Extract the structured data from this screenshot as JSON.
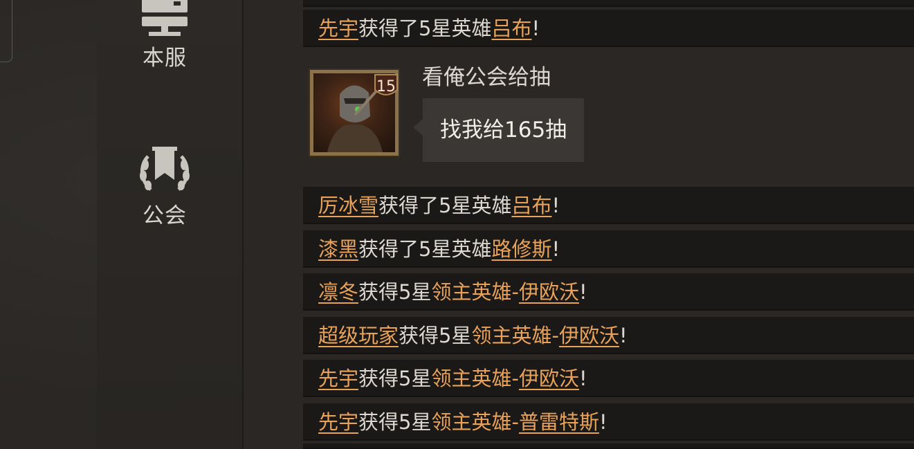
{
  "sidebar": {
    "items": [
      {
        "label": "本服",
        "icon": "server-icon"
      },
      {
        "label": "公会",
        "icon": "guild-laurel-icon"
      }
    ]
  },
  "chat": {
    "messages": [
      {
        "type": "system",
        "player": "先宇",
        "verb": "获得了5星英雄",
        "hero": "吕布",
        "end": "!"
      },
      {
        "type": "user",
        "sender": "看俺公会给抽",
        "level": "15",
        "text": "找我给165抽",
        "avatar_icon": "armored-knight-avatar-icon"
      },
      {
        "type": "system",
        "player": "厉冰雪",
        "verb": "获得了5星英雄",
        "hero": "吕布",
        "end": "!"
      },
      {
        "type": "system",
        "player": "漆黑",
        "verb": "获得了5星英雄",
        "hero": "路修斯",
        "end": "!"
      },
      {
        "type": "system",
        "player": "凛冬",
        "verb": "获得5星",
        "rank": "领主英雄-",
        "hero": "伊欧沃",
        "end": "!"
      },
      {
        "type": "system",
        "player": "超级玩家",
        "verb": "获得5星",
        "rank": "领主英雄-",
        "hero": "伊欧沃",
        "end": "!"
      },
      {
        "type": "system",
        "player": "先宇",
        "verb": "获得5星",
        "rank": "领主英雄-",
        "hero": "伊欧沃",
        "end": "!"
      },
      {
        "type": "system",
        "player": "先宇",
        "verb": "获得5星",
        "rank": "领主英雄-",
        "hero": "普雷特斯",
        "end": "!"
      }
    ]
  },
  "colors": {
    "highlight": "#e9a25a",
    "text": "#ddd8d1",
    "row_bg": "#1b1917",
    "bubble_bg": "#3b3734"
  }
}
